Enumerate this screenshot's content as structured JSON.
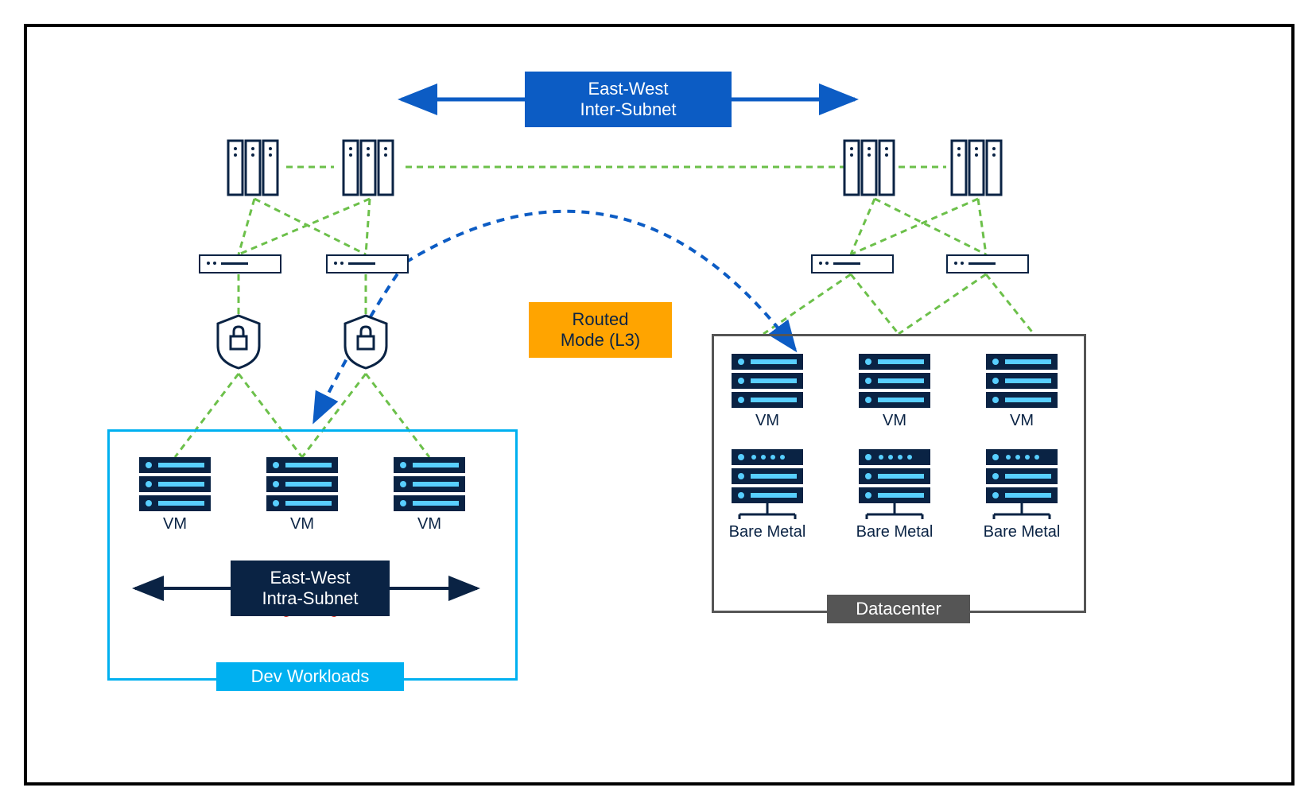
{
  "labels": {
    "east_west_inter": "East-West\nInter-Subnet",
    "routed_mode": "Routed\nMode (L3)",
    "east_west_intra": "East-West\nIntra-Subnet",
    "dev_workloads": "Dev Workloads",
    "datacenter": "Datacenter",
    "vm": "VM",
    "bare_metal": "Bare Metal"
  },
  "colors": {
    "blue": "#0c5cc4",
    "orange": "#ffa400",
    "dark_navy": "#0a2344",
    "cyan": "#00b0f0",
    "gray": "#555555",
    "green_dash": "#6cc04a",
    "red_x": "#d52b1e",
    "light_cyan": "#58cfff"
  },
  "diagram": {
    "description": "Network topology showing East-West traffic flow in routed (L3) mode between dev workloads and datacenter",
    "left_side": {
      "spines": 2,
      "leafs": 2,
      "firewalls": 2,
      "vms": 3,
      "container_label": "Dev Workloads",
      "intra_subnet_blocked": true
    },
    "right_side": {
      "spines": 2,
      "leafs": 2,
      "vms": 3,
      "bare_metals": 3,
      "container_label": "Datacenter"
    },
    "connections": {
      "inter_subnet_arrow": "bidirectional top",
      "routed_flow": "dashed blue curve from left leaf to right datacenter",
      "leaf_spine": "green dashed mesh"
    }
  }
}
